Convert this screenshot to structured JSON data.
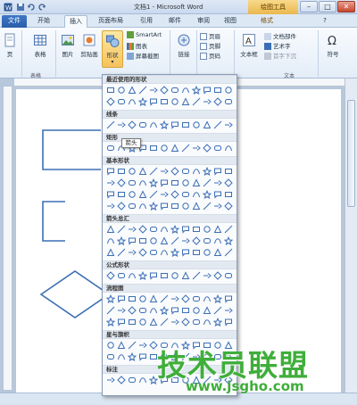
{
  "window": {
    "title": "文档1 - Microsoft Word",
    "tools_tab": "绘图工具",
    "controls": {
      "minimize": "–",
      "maximize": "□",
      "close": "✕"
    }
  },
  "tabs": [
    {
      "label": "文件",
      "state": "file"
    },
    {
      "label": "开始",
      "state": "normal"
    },
    {
      "label": "插入",
      "state": "active"
    },
    {
      "label": "页面布局",
      "state": "normal"
    },
    {
      "label": "引用",
      "state": "normal"
    },
    {
      "label": "邮件",
      "state": "normal"
    },
    {
      "label": "审阅",
      "state": "normal"
    },
    {
      "label": "视图",
      "state": "normal"
    },
    {
      "label": "格式",
      "state": "format"
    }
  ],
  "ribbon": {
    "pages_label": "页",
    "table_label": "表格",
    "table_group": "表格",
    "picture_label": "图片",
    "clipart_label": "剪贴画",
    "shapes_label": "形状",
    "smartart_label": "SmartArt",
    "chart_label": "图表",
    "screenshot_label": "屏幕截图",
    "links_label": "链接",
    "header_label": "页眉",
    "footer_label": "页脚",
    "pagenum_label": "页码",
    "textbox_label": "文本框",
    "docparts_label": "文档部件",
    "wordart_label": "艺术字",
    "dropcap_label": "首字下沉",
    "symbol_label": "符号",
    "text_group": "文本"
  },
  "dropdown": {
    "sections": [
      {
        "title": "最近使用的形状",
        "rows": 2
      },
      {
        "title": "线条",
        "rows": 1
      },
      {
        "title": "矩形",
        "rows": 1
      },
      {
        "title": "基本形状",
        "rows": 4
      },
      {
        "title": "箭头总汇",
        "rows": 3
      },
      {
        "title": "公式形状",
        "rows": 1
      },
      {
        "title": "流程图",
        "rows": 3
      },
      {
        "title": "星与旗帜",
        "rows": 2
      },
      {
        "title": "标注",
        "rows": 1
      }
    ],
    "tooltip": "箭头"
  },
  "watermark": {
    "name": "技术员联盟",
    "url": "www.jsgho.com"
  },
  "colors": {
    "accent": "#2a5ea8",
    "ribbon_bg": "#e4edf8",
    "shape_stroke": "#3b6fb5",
    "watermark": "#3fae3a"
  }
}
